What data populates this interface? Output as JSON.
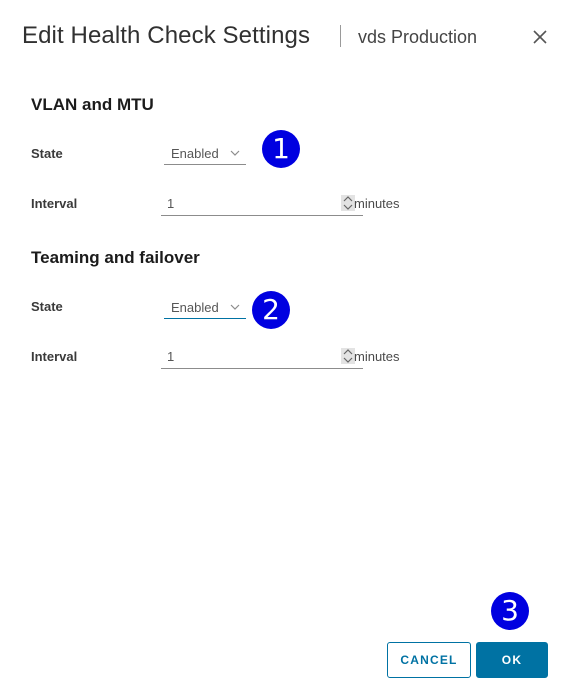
{
  "dialog": {
    "title": "Edit Health Check Settings",
    "subtitle": "vds Production",
    "close_icon": "close-icon"
  },
  "sections": [
    {
      "title": "VLAN and MTU",
      "state_label": "State",
      "state_value": "Enabled",
      "interval_label": "Interval",
      "interval_value": "1",
      "interval_unit": "minutes"
    },
    {
      "title": "Teaming and failover",
      "state_label": "State",
      "state_value": "Enabled",
      "interval_label": "Interval",
      "interval_value": "1",
      "interval_unit": "minutes"
    }
  ],
  "annotations": [
    "1",
    "2",
    "3"
  ],
  "footer": {
    "cancel_label": "CANCEL",
    "ok_label": "OK"
  },
  "colors": {
    "accent": "#0072a3",
    "badge": "#0000e0"
  }
}
